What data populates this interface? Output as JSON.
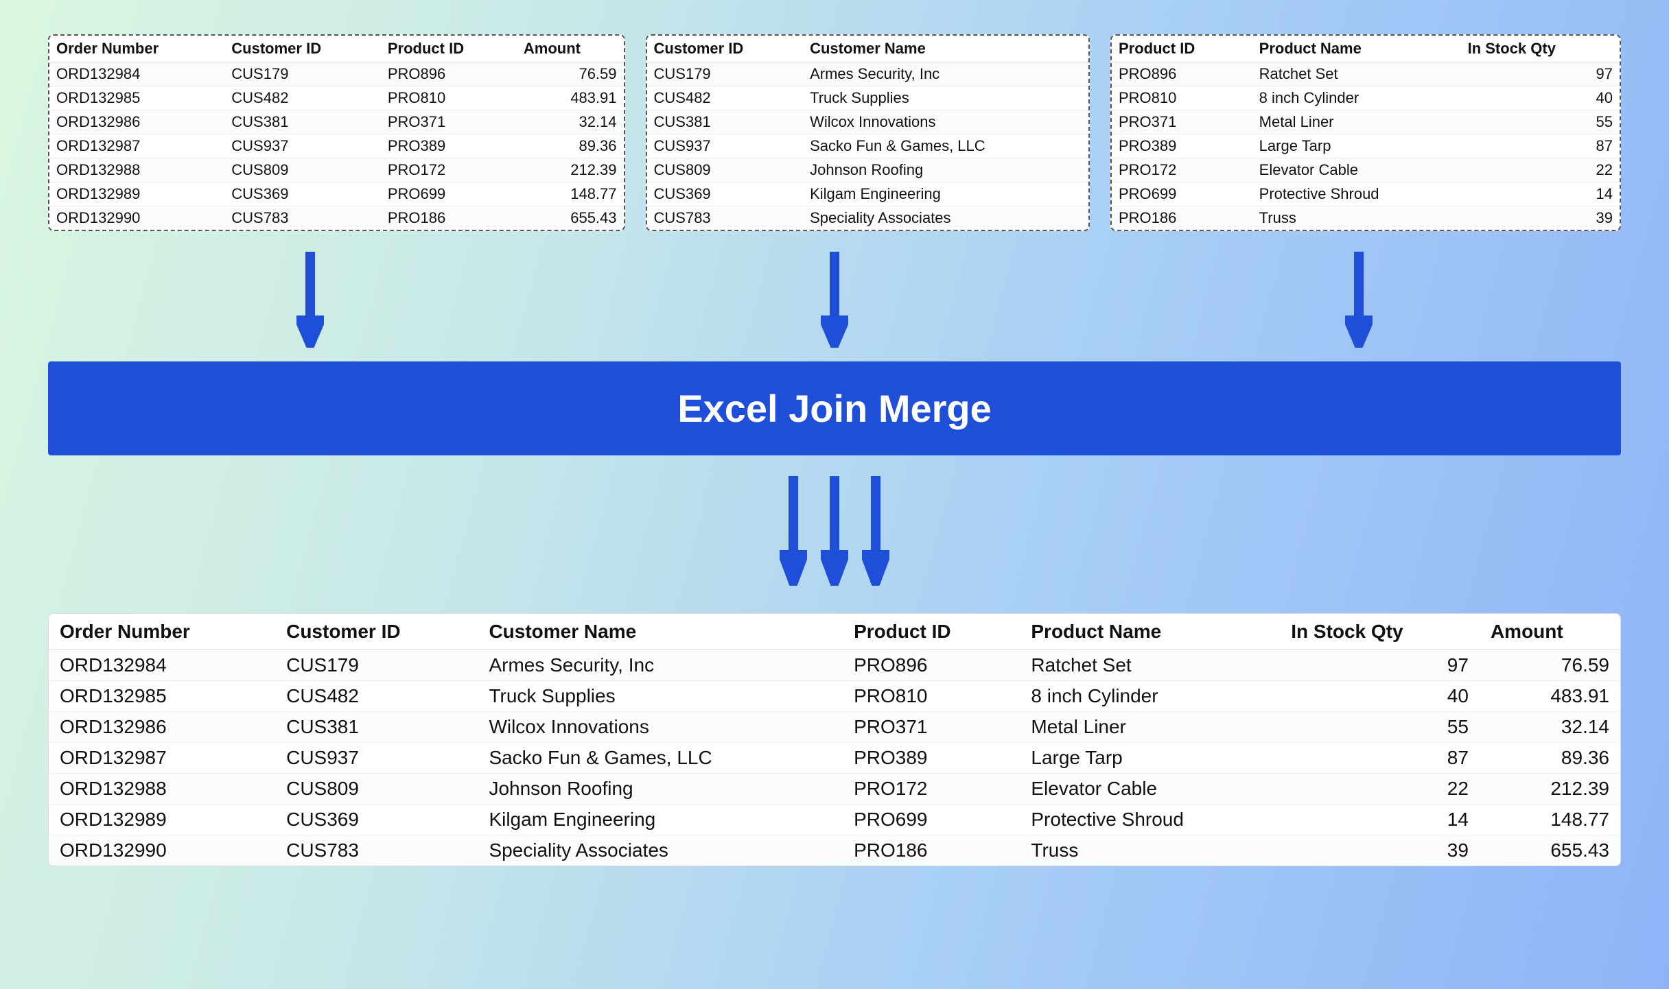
{
  "banner": "Excel Join Merge",
  "tables": {
    "orders": {
      "headers": [
        "Order Number",
        "Customer ID",
        "Product ID",
        "Amount"
      ],
      "rows": [
        [
          "ORD132984",
          "CUS179",
          "PRO896",
          "76.59"
        ],
        [
          "ORD132985",
          "CUS482",
          "PRO810",
          "483.91"
        ],
        [
          "ORD132986",
          "CUS381",
          "PRO371",
          "32.14"
        ],
        [
          "ORD132987",
          "CUS937",
          "PRO389",
          "89.36"
        ],
        [
          "ORD132988",
          "CUS809",
          "PRO172",
          "212.39"
        ],
        [
          "ORD132989",
          "CUS369",
          "PRO699",
          "148.77"
        ],
        [
          "ORD132990",
          "CUS783",
          "PRO186",
          "655.43"
        ]
      ],
      "numeric_cols": [
        3
      ]
    },
    "customers": {
      "headers": [
        "Customer ID",
        "Customer Name"
      ],
      "rows": [
        [
          "CUS179",
          "Armes Security, Inc"
        ],
        [
          "CUS482",
          "Truck Supplies"
        ],
        [
          "CUS381",
          "Wilcox Innovations"
        ],
        [
          "CUS937",
          "Sacko Fun & Games, LLC"
        ],
        [
          "CUS809",
          "Johnson Roofing"
        ],
        [
          "CUS369",
          "Kilgam Engineering"
        ],
        [
          "CUS783",
          "Speciality Associates"
        ]
      ],
      "numeric_cols": []
    },
    "products": {
      "headers": [
        "Product ID",
        "Product Name",
        "In Stock Qty"
      ],
      "rows": [
        [
          "PRO896",
          "Ratchet Set",
          "97"
        ],
        [
          "PRO810",
          "8 inch Cylinder",
          "40"
        ],
        [
          "PRO371",
          "Metal Liner",
          "55"
        ],
        [
          "PRO389",
          "Large Tarp",
          "87"
        ],
        [
          "PRO172",
          "Elevator Cable",
          "22"
        ],
        [
          "PRO699",
          "Protective Shroud",
          "14"
        ],
        [
          "PRO186",
          "Truss",
          "39"
        ]
      ],
      "numeric_cols": [
        2
      ]
    },
    "result": {
      "headers": [
        "Order Number",
        "Customer ID",
        "Customer Name",
        "Product ID",
        "Product Name",
        "In Stock Qty",
        "Amount"
      ],
      "rows": [
        [
          "ORD132984",
          "CUS179",
          "Armes Security, Inc",
          "PRO896",
          "Ratchet Set",
          "97",
          "76.59"
        ],
        [
          "ORD132985",
          "CUS482",
          "Truck Supplies",
          "PRO810",
          "8 inch Cylinder",
          "40",
          "483.91"
        ],
        [
          "ORD132986",
          "CUS381",
          "Wilcox Innovations",
          "PRO371",
          "Metal Liner",
          "55",
          "32.14"
        ],
        [
          "ORD132987",
          "CUS937",
          "Sacko Fun & Games, LLC",
          "PRO389",
          "Large Tarp",
          "87",
          "89.36"
        ],
        [
          "ORD132988",
          "CUS809",
          "Johnson Roofing",
          "PRO172",
          "Elevator Cable",
          "22",
          "212.39"
        ],
        [
          "ORD132989",
          "CUS369",
          "Kilgam Engineering",
          "PRO699",
          "Protective Shroud",
          "14",
          "148.77"
        ],
        [
          "ORD132990",
          "CUS783",
          "Speciality Associates",
          "PRO186",
          "Truss",
          "39",
          "655.43"
        ]
      ],
      "numeric_cols": [
        5,
        6
      ]
    }
  },
  "arrow_color": "#1f4fd8"
}
